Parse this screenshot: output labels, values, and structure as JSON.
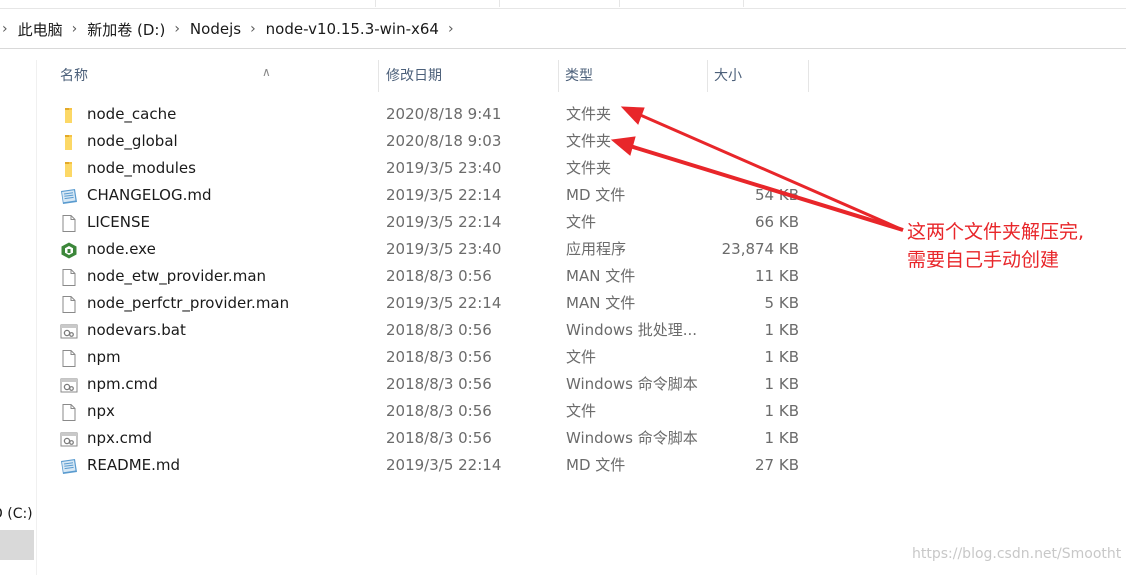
{
  "breadcrumb": {
    "items": [
      "此电脑",
      "新加卷 (D:)",
      "Nodejs",
      "node-v10.15.3-win-x64"
    ]
  },
  "columns": {
    "name": "名称",
    "date": "修改日期",
    "type": "类型",
    "size": "大小"
  },
  "nav": {
    "drive_label": "D (C:)"
  },
  "files": [
    {
      "name": "node_cache",
      "date": "2020/8/18 9:41",
      "type": "文件夹",
      "size": "",
      "icon": "folder-icon"
    },
    {
      "name": "node_global",
      "date": "2020/8/18 9:03",
      "type": "文件夹",
      "size": "",
      "icon": "folder-icon"
    },
    {
      "name": "node_modules",
      "date": "2019/3/5 23:40",
      "type": "文件夹",
      "size": "",
      "icon": "folder-icon"
    },
    {
      "name": "CHANGELOG.md",
      "date": "2019/3/5 22:14",
      "type": "MD 文件",
      "size": "54 KB",
      "icon": "markdown-file-icon"
    },
    {
      "name": "LICENSE",
      "date": "2019/3/5 22:14",
      "type": "文件",
      "size": "66 KB",
      "icon": "file-icon"
    },
    {
      "name": "node.exe",
      "date": "2019/3/5 23:40",
      "type": "应用程序",
      "size": "23,874 KB",
      "icon": "nodejs-exe-icon"
    },
    {
      "name": "node_etw_provider.man",
      "date": "2018/8/3 0:56",
      "type": "MAN 文件",
      "size": "11 KB",
      "icon": "file-icon"
    },
    {
      "name": "node_perfctr_provider.man",
      "date": "2019/3/5 22:14",
      "type": "MAN 文件",
      "size": "5 KB",
      "icon": "file-icon"
    },
    {
      "name": "nodevars.bat",
      "date": "2018/8/3 0:56",
      "type": "Windows 批处理...",
      "size": "1 KB",
      "icon": "batch-file-icon"
    },
    {
      "name": "npm",
      "date": "2018/8/3 0:56",
      "type": "文件",
      "size": "1 KB",
      "icon": "file-icon"
    },
    {
      "name": "npm.cmd",
      "date": "2018/8/3 0:56",
      "type": "Windows 命令脚本",
      "size": "1 KB",
      "icon": "batch-file-icon"
    },
    {
      "name": "npx",
      "date": "2018/8/3 0:56",
      "type": "文件",
      "size": "1 KB",
      "icon": "file-icon"
    },
    {
      "name": "npx.cmd",
      "date": "2018/8/3 0:56",
      "type": "Windows 命令脚本",
      "size": "1 KB",
      "icon": "batch-file-icon"
    },
    {
      "name": "README.md",
      "date": "2019/3/5 22:14",
      "type": "MD 文件",
      "size": "27 KB",
      "icon": "markdown-file-icon"
    }
  ],
  "annotation": {
    "line1": "这两个文件夹解压完,",
    "line2": "需要自己手动创建",
    "color": "#e8262a"
  },
  "watermark": "https://blog.csdn.net/Smootht",
  "colors": {
    "folder": "#f6c346",
    "header_text": "#4c607a",
    "secondary_text": "#6b6b6b"
  }
}
